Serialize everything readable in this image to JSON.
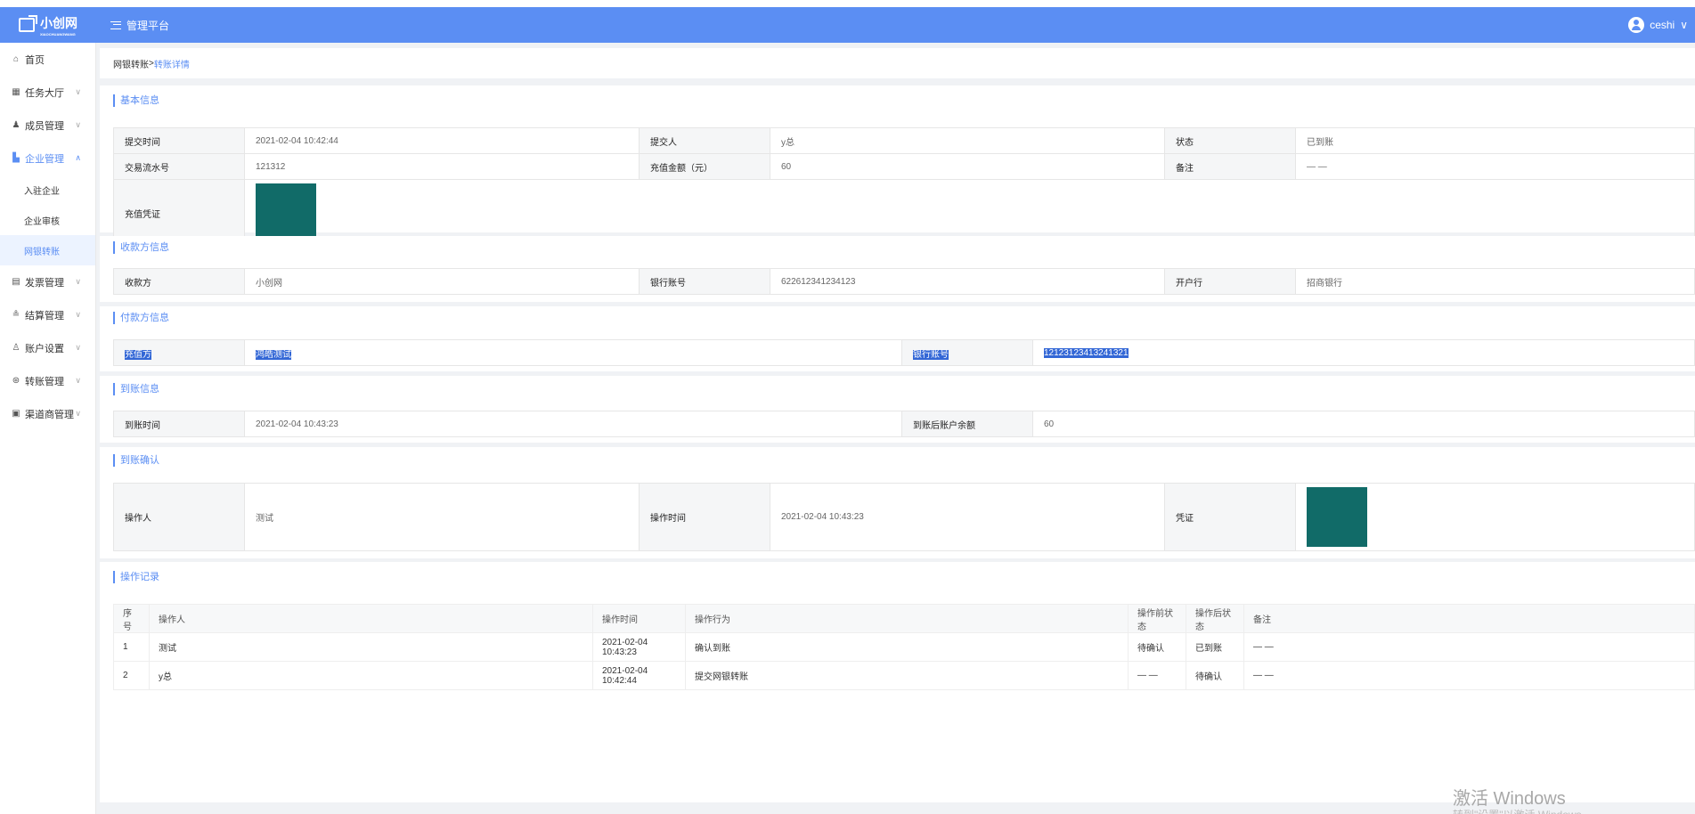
{
  "header": {
    "logo_text": "小创网",
    "logo_sub": "XIAOCHUANGWANG",
    "title": "管理平台",
    "username": "ceshi"
  },
  "sidebar": {
    "items": [
      {
        "label": "首页",
        "icon": "home-icon"
      },
      {
        "label": "任务大厅",
        "icon": "calendar-icon"
      },
      {
        "label": "成员管理",
        "icon": "user-icon"
      },
      {
        "label": "企业管理",
        "icon": "building-icon"
      },
      {
        "label": "发票管理",
        "icon": "invoice-icon"
      },
      {
        "label": "结算管理",
        "icon": "settlement-icon"
      },
      {
        "label": "账户设置",
        "icon": "account-icon"
      },
      {
        "label": "转账管理",
        "icon": "transfer-icon"
      },
      {
        "label": "渠道商管理",
        "icon": "channel-icon"
      }
    ],
    "sub_items": [
      "入驻企业",
      "企业审核",
      "网银转账"
    ]
  },
  "breadcrumb": {
    "parent": "网银转账",
    "separator": " > ",
    "current": "转账详情"
  },
  "basic": {
    "title": "基本信息",
    "submit_time_label": "提交时间",
    "submit_time": "2021-02-04 10:42:44",
    "submitter_label": "提交人",
    "submitter": "y总",
    "status_label": "状态",
    "status": "已到账",
    "serial_label": "交易流水号",
    "serial": "121312",
    "amount_label": "充值金额（元）",
    "amount": "60",
    "remark_label": "备注",
    "remark": "— —",
    "voucher_label": "充值凭证"
  },
  "payee": {
    "title": "收款方信息",
    "payee_label": "收款方",
    "payee": "小创网",
    "account_label": "银行账号",
    "account": "622612341234123",
    "bank_label": "开户行",
    "bank": "招商银行"
  },
  "payer": {
    "title": "付款方信息",
    "payer_label": "充值方",
    "payer": "鸿皓测试",
    "account_label": "银行账号",
    "account": "12123123413241321"
  },
  "arrival": {
    "title": "到账信息",
    "time_label": "到账时间",
    "time": "2021-02-04 10:43:23",
    "balance_label": "到账后账户余额",
    "balance": "60"
  },
  "confirm": {
    "title": "到账确认",
    "operator_label": "操作人",
    "operator": "测试",
    "op_time_label": "操作时间",
    "op_time": "2021-02-04 10:43:23",
    "voucher_label": "凭证"
  },
  "log": {
    "title": "操作记录",
    "headers": [
      "序号",
      "操作人",
      "操作时间",
      "操作行为",
      "操作前状态",
      "操作后状态",
      "备注"
    ],
    "rows": [
      [
        "1",
        "测试",
        "2021-02-04 10:43:23",
        "确认到账",
        "待确认",
        "已到账",
        "— —"
      ],
      [
        "2",
        "y总",
        "2021-02-04 10:42:44",
        "提交网银转账",
        "— —",
        "待确认",
        "— —"
      ]
    ]
  },
  "watermark": {
    "line1": "激活 Windows",
    "line2": "转到\"设置\"以激活 Windows。"
  },
  "colors": {
    "header": "#5b8ef3",
    "accent": "#5b8ef3",
    "voucher": "#116b68",
    "selection": "#3367d6"
  }
}
